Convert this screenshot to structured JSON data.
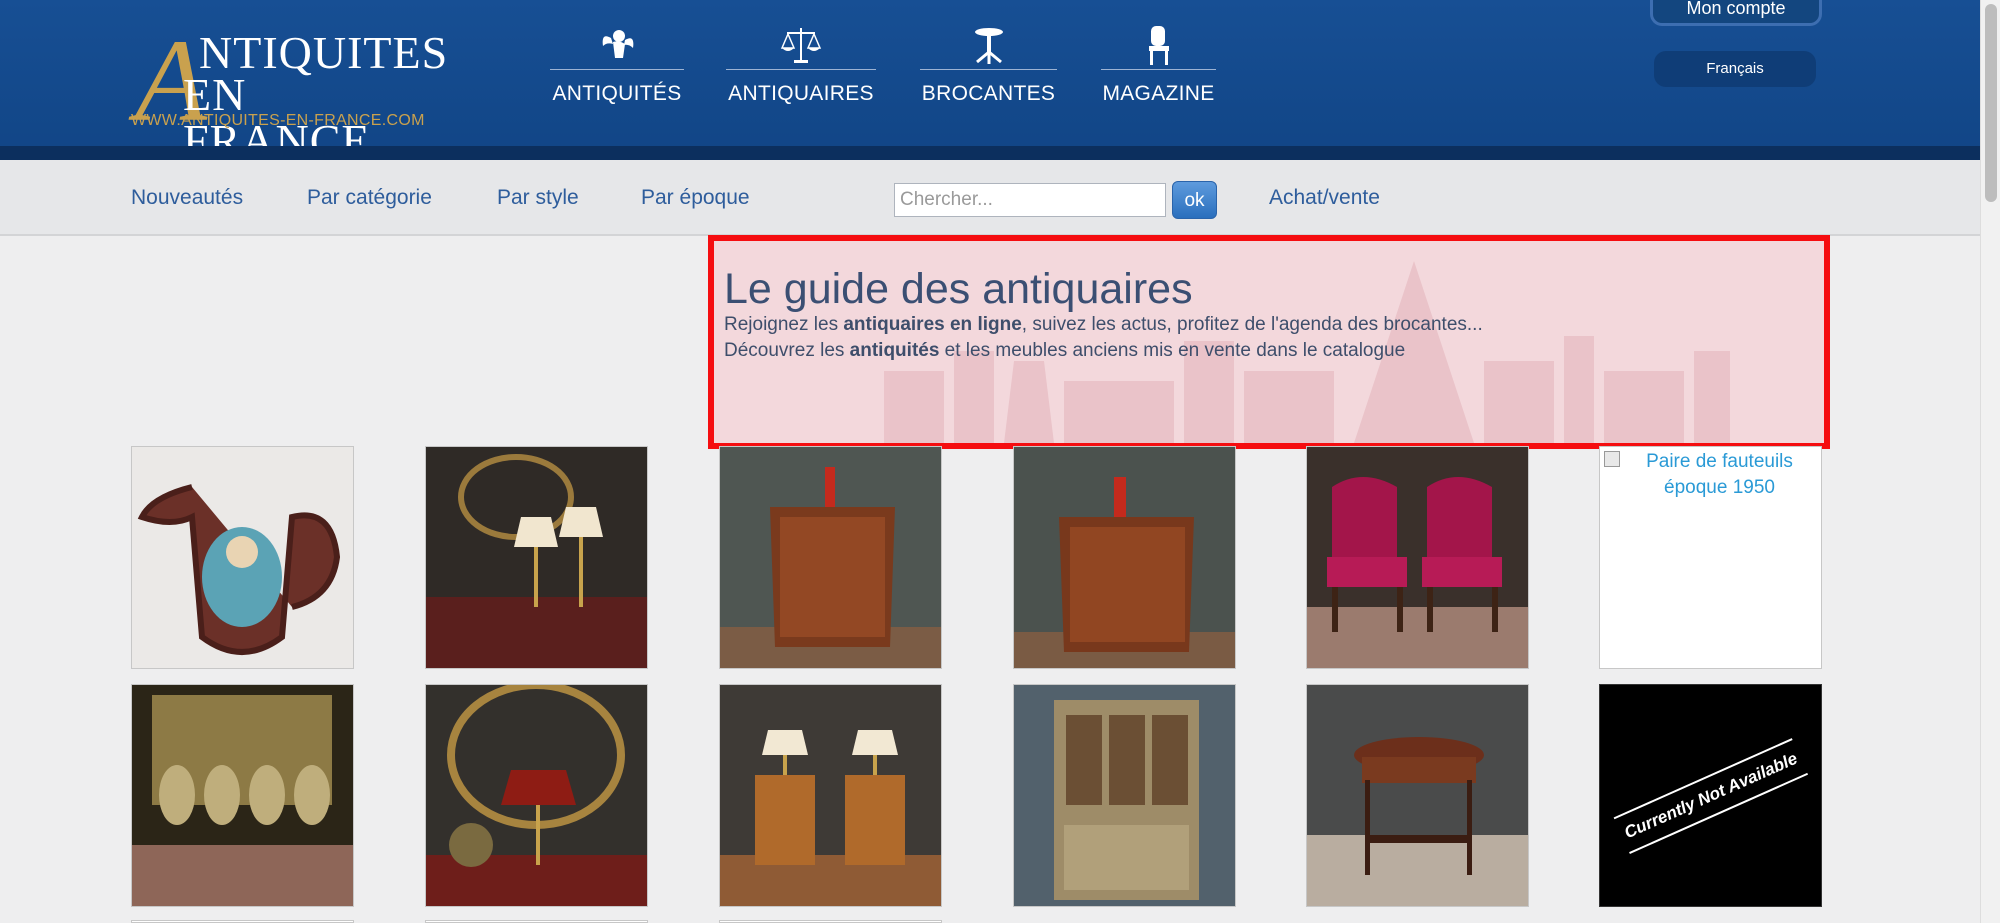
{
  "header": {
    "logo": {
      "big_letter": "A",
      "line1": "NTIQUITES",
      "line2": "EN FRANCE",
      "url": "WWW.ANTIQUITES-EN-FRANCE.COM"
    },
    "main_nav": [
      {
        "label": "ANTIQUITÉS",
        "icon": "cherub-icon"
      },
      {
        "label": "ANTIQUAIRES",
        "icon": "scales-icon"
      },
      {
        "label": "BROCANTES",
        "icon": "pedestal-table-icon"
      },
      {
        "label": "MAGAZINE",
        "icon": "chair-icon"
      }
    ],
    "account_label": "Mon compte",
    "language_label": "Français"
  },
  "subnav": {
    "links": [
      "Nouveautés",
      "Par catégorie",
      "Par style",
      "Par époque"
    ],
    "search_placeholder": "Chercher...",
    "search_button": "ok",
    "buy_sell": "Achat/vente"
  },
  "hero": {
    "title": "Le guide des antiquaires",
    "line1_before": "Rejoignez les ",
    "line1_bold": "antiquaires en ligne",
    "line1_after": ", suivez les actus, profitez de l'agenda des brocantes...",
    "line2_before": "Découvrez les ",
    "line2_bold": "antiquités",
    "line2_after": " et les meubles anciens mis en vente dans le catalogue"
  },
  "products": {
    "broken_alt_text": "Paire de fauteuils époque 1950",
    "not_available_text": "Currently Not Available"
  },
  "colors": {
    "header_blue": "#174f94",
    "gold": "#c9a14e",
    "link_blue": "#2e5d9c",
    "highlight_red": "#f50d10"
  }
}
